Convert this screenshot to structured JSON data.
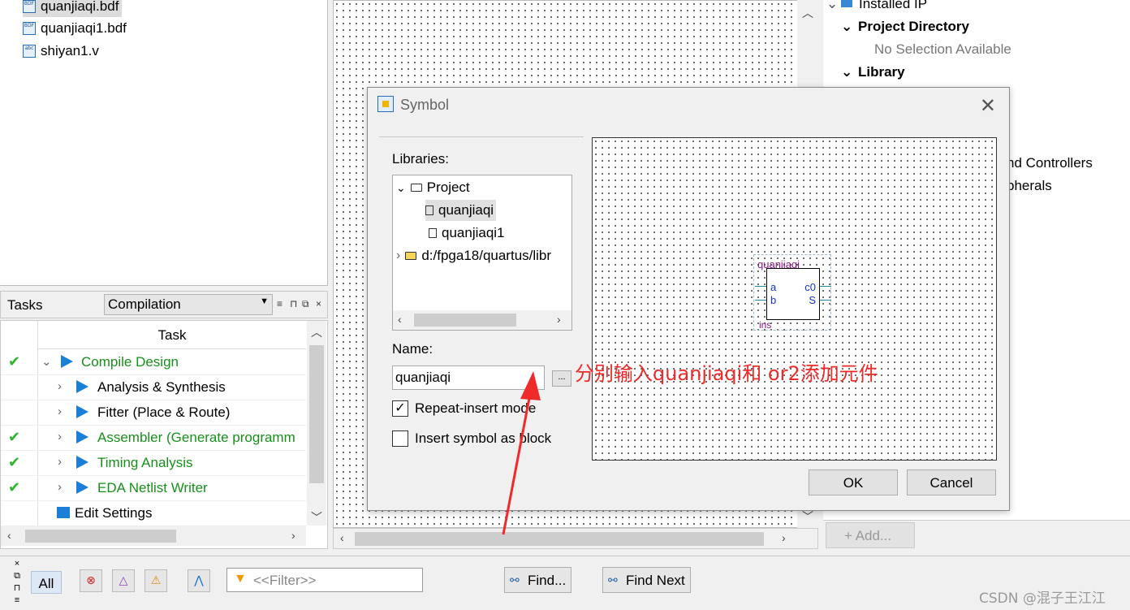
{
  "project_files": [
    {
      "name": "quanjiaqi.bdf",
      "icon": "bdf-file-icon",
      "selected": true
    },
    {
      "name": "quanjiaqi1.bdf",
      "icon": "bdf-file-icon",
      "selected": false
    },
    {
      "name": "shiyan1.v",
      "icon": "verilog-file-icon",
      "selected": false
    }
  ],
  "tasks": {
    "label": "Tasks",
    "flow": "Compilation",
    "column_header": "Task",
    "rows": [
      {
        "label": "Compile Design",
        "done": true,
        "green": true
      },
      {
        "label": "Analysis & Synthesis",
        "done": false,
        "green": false
      },
      {
        "label": "Fitter (Place & Route)",
        "done": false,
        "green": false
      },
      {
        "label": "Assembler (Generate programm",
        "done": true,
        "green": true
      },
      {
        "label": "Timing Analysis",
        "done": true,
        "green": true
      },
      {
        "label": "EDA Netlist Writer",
        "done": true,
        "green": true
      },
      {
        "label": "Edit Settings",
        "done": false,
        "green": false
      }
    ]
  },
  "ip_catalog": {
    "installed_ip": "Installed IP",
    "project_directory": "Project Directory",
    "no_selection": "No Selection Available",
    "library": "Library",
    "partial_controllers": "nd Controllers",
    "partial_peripherals": "pherals",
    "add_button": "+ Add..."
  },
  "symbol_dialog": {
    "title": "Symbol",
    "libraries_label": "Libraries:",
    "tree": {
      "project": "Project",
      "items": [
        "quanjiaqi",
        "quanjiaqi1"
      ],
      "library_path": "d:/fpga18/quartus/libr"
    },
    "name_label": "Name:",
    "name_value": "quanjiaqi",
    "browse_label": "...",
    "repeat_insert_label": "Repeat-insert mode",
    "repeat_insert_checked": true,
    "insert_block_label": "Insert symbol as block",
    "insert_block_checked": false,
    "preview": {
      "symbol_name": "quanjiaqi",
      "ports_in": [
        "a",
        "b"
      ],
      "ports_out": [
        "c0",
        "S"
      ],
      "instance": "ins"
    },
    "ok_label": "OK",
    "cancel_label": "Cancel"
  },
  "annotation": "分别输入quanjiaqi和  or2添加元件",
  "messages_bar": {
    "all_label": "All",
    "filter_placeholder": "<<Filter>>",
    "find_label": "Find...",
    "find_next_label": "Find Next"
  },
  "watermark": "CSDN @混子王江江",
  "colors": {
    "task_green": "#17901b",
    "annotation_red": "#ee2a2a",
    "play_blue": "#1a7fd6",
    "symbol_purple": "#8b1a8b"
  }
}
